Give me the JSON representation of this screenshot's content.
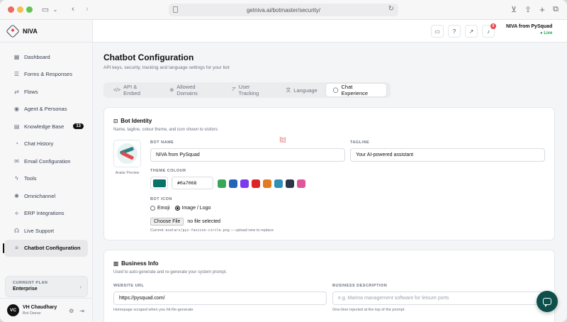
{
  "browser": {
    "url": "getniva.ai/botmaster/security/"
  },
  "sidebar": {
    "brand": "NIVA",
    "items": [
      {
        "label": "Dashboard",
        "icon": "dashboard-icon",
        "glyph": "▦"
      },
      {
        "label": "Forms & Responses",
        "icon": "forms-icon",
        "glyph": "☰"
      },
      {
        "label": "Flows",
        "icon": "flows-icon",
        "glyph": "⇄"
      },
      {
        "label": "Agent & Personas",
        "icon": "agent-icon",
        "glyph": "◉"
      },
      {
        "label": "Knowledge Base",
        "icon": "book-icon",
        "glyph": "▤",
        "badge": "13"
      },
      {
        "label": "Chat History",
        "icon": "history-icon",
        "glyph": "◔"
      },
      {
        "label": "Email Configuration",
        "icon": "mail-icon",
        "glyph": "✉"
      },
      {
        "label": "Tools",
        "icon": "bolt-icon",
        "glyph": "ϟ"
      },
      {
        "label": "Omnichannel",
        "icon": "omnichannel-icon",
        "glyph": "✺"
      },
      {
        "label": "ERP Integrations",
        "icon": "erp-icon",
        "glyph": "⟡"
      },
      {
        "label": "Live Support",
        "icon": "headset-icon",
        "glyph": "☊"
      },
      {
        "label": "Chatbot Configuration",
        "icon": "sliders-icon",
        "glyph": "≡",
        "active": true
      }
    ],
    "plan": {
      "label": "CURRENT PLAN",
      "value": "Enterprise"
    },
    "user": {
      "initials": "VC",
      "name": "VH Chaudhary",
      "role": "Bot Owner"
    }
  },
  "topbar": {
    "notification_count": "6",
    "bot_name": "NIVA from PySquad",
    "status": "● Live"
  },
  "main": {
    "title": "Chatbot Configuration",
    "subtitle": "API keys, security, tracking and language settings for your bot",
    "tabs": [
      {
        "label": "API & Embed",
        "icon": "code-icon",
        "glyph": "</>"
      },
      {
        "label": "Allowed Domains",
        "icon": "globe-icon",
        "glyph": "⊕"
      },
      {
        "label": "User Tracking",
        "icon": "chart-icon",
        "glyph": "⦢"
      },
      {
        "label": "Language",
        "icon": "translate-icon",
        "glyph": "文"
      },
      {
        "label": "Chat Experience",
        "icon": "chat-icon",
        "glyph": "◯",
        "active": true
      }
    ]
  },
  "identity": {
    "title": "Bot Identity",
    "subtitle": "Name, tagline, colour theme, and icon shown to visitors",
    "avatar_caption": "Avatar Preview",
    "bot_name_label": "BOT NAME",
    "bot_name_value": "NIVA from PySquad",
    "tagline_label": "TAGLINE",
    "tagline_value": "Your AI-powered assistant",
    "theme_label": "THEME COLOUR",
    "theme_value": "#0a7068",
    "theme_color": "#0a7068",
    "swatches": [
      "#3aa655",
      "#2563b6",
      "#7c3aed",
      "#dc2626",
      "#e07b1f",
      "#2f8fb5",
      "#2d3446",
      "#e0559a"
    ],
    "icon_label": "BOT ICON",
    "icon_options": [
      "Emoji",
      "Image / Logo"
    ],
    "file_button": "Choose File",
    "file_status": "no file selected",
    "hint_prefix": "Current: ",
    "hint_path": "avatars/pys-favicon-circle.png",
    "hint_suffix": " — upload new to replace",
    "debug_line1": "Test",
    "debug_line2": "Test"
  },
  "business": {
    "title": "Business Info",
    "subtitle": "Used to auto-generate and re-generate your system prompt.",
    "url_label": "WEBSITE URL",
    "url_value": "https://pysquad.com/",
    "url_hint": "Homepage scraped when you hit Re-generate",
    "desc_label": "BUSINESS DESCRIPTION",
    "desc_placeholder": "e.g. Marina management software for leisure ports",
    "desc_hint": "One-liner injected at the top of the prompt"
  }
}
